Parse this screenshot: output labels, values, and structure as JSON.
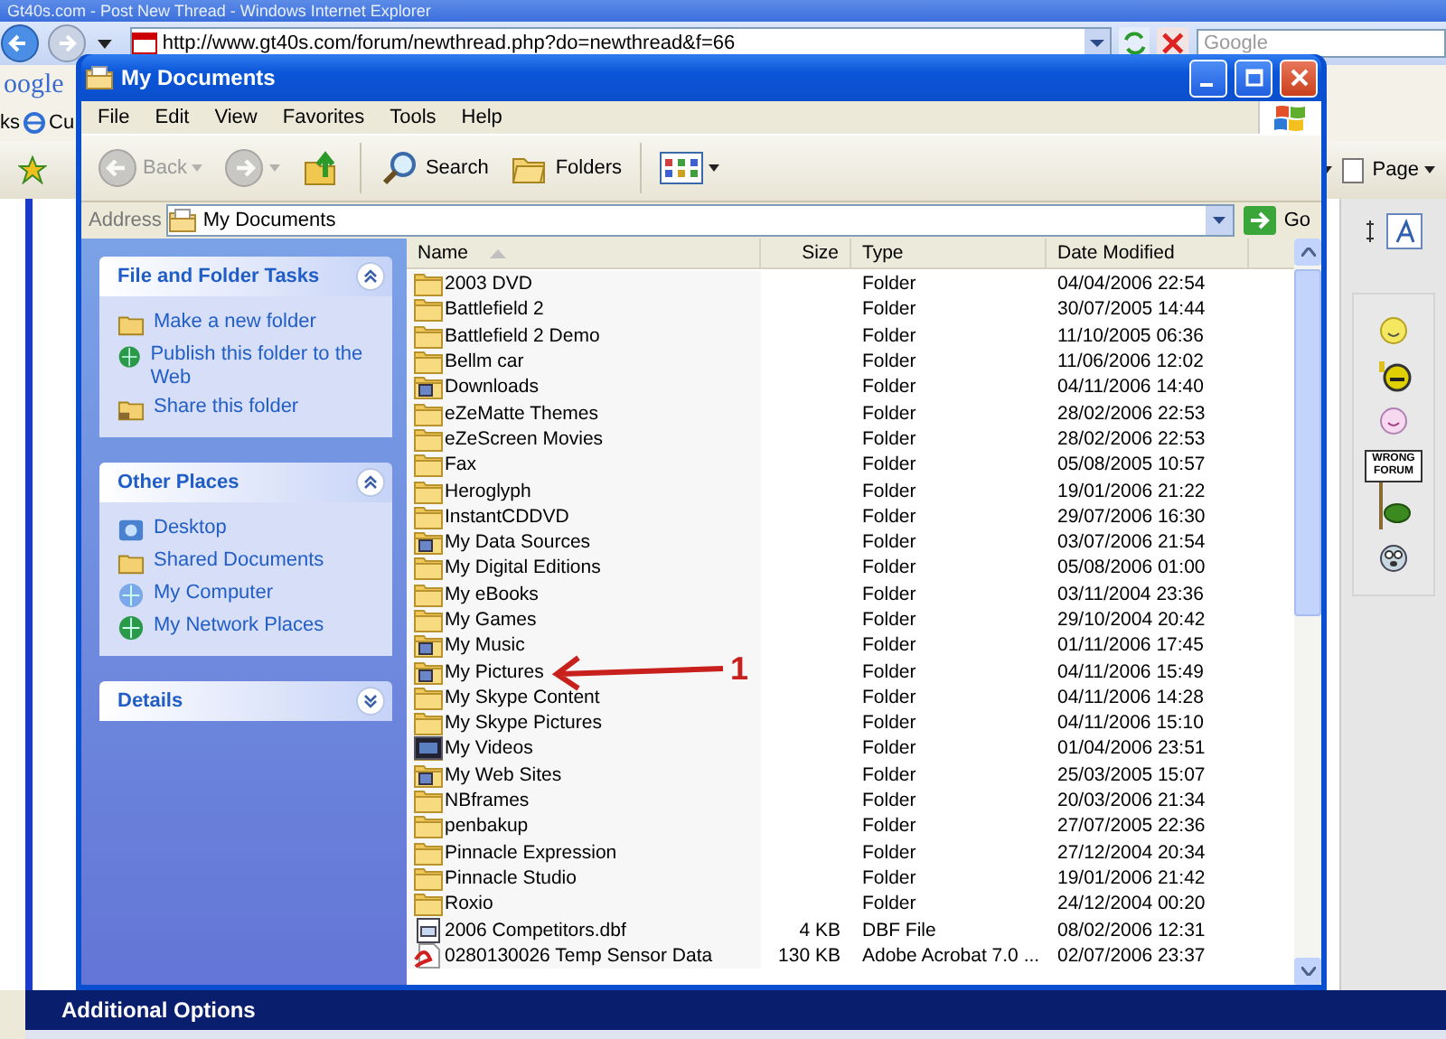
{
  "browser": {
    "title": "Gt40s.com - Post New Thread - Windows Internet Explorer",
    "url": "http://www.gt40s.com/forum/newthread.php?do=newthread&f=66",
    "search": {
      "placeholder": "Google"
    },
    "toolbar_logo": "oogle",
    "links_label": "ks",
    "link": "Cu",
    "page_button": "Page",
    "section_title": "Additional Options",
    "smiley_sign": "WRONG FORUM"
  },
  "window": {
    "title": "My Documents",
    "menu": [
      "File",
      "Edit",
      "View",
      "Favorites",
      "Tools",
      "Help"
    ],
    "toolbar": [
      {
        "kind": "back",
        "label": "Back",
        "disabled": true
      },
      {
        "kind": "forward",
        "disabled": true
      },
      {
        "kind": "up",
        "disabled": false
      },
      {
        "kind": "search",
        "label": "Search",
        "disabled": false
      },
      {
        "kind": "folders",
        "label": "Folders",
        "disabled": false
      },
      {
        "kind": "views",
        "disabled": false
      }
    ],
    "address": {
      "label": "Address",
      "value": "My Documents",
      "go": "Go"
    },
    "panes": [
      {
        "title": "File and Folder Tasks",
        "expanded": true,
        "items": [
          {
            "kind": "new-folder",
            "label": "Make a new folder"
          },
          {
            "kind": "publish",
            "label": "Publish this folder to the Web"
          },
          {
            "kind": "share",
            "label": "Share this folder"
          }
        ]
      },
      {
        "title": "Other Places",
        "expanded": true,
        "items": [
          {
            "kind": "desktop",
            "label": "Desktop"
          },
          {
            "kind": "shared",
            "label": "Shared Documents"
          },
          {
            "kind": "computer",
            "label": "My Computer"
          },
          {
            "kind": "network",
            "label": "My Network Places"
          }
        ]
      },
      {
        "title": "Details",
        "expanded": false
      }
    ],
    "columns": [
      {
        "label": "Name",
        "sorted": true
      },
      {
        "label": "Size",
        "sorted": false
      },
      {
        "label": "Type",
        "sorted": false
      },
      {
        "label": "Date Modified",
        "sorted": false
      }
    ],
    "files": [
      {
        "kind": "folder",
        "name": "2003 DVD",
        "type": "Folder",
        "date": "04/04/2006 22:54"
      },
      {
        "kind": "folder",
        "name": "Battlefield 2",
        "type": "Folder",
        "date": "30/07/2005 14:44"
      },
      {
        "kind": "folder",
        "name": "Battlefield 2 Demo",
        "type": "Folder",
        "date": "11/10/2005 06:36"
      },
      {
        "kind": "folder",
        "name": "Bellm car",
        "type": "Folder",
        "date": "11/06/2006 12:02"
      },
      {
        "kind": "special",
        "name": "Downloads",
        "type": "Folder",
        "date": "04/11/2006 14:40"
      },
      {
        "kind": "folder",
        "name": "eZeMatte Themes",
        "type": "Folder",
        "date": "28/02/2006 22:53"
      },
      {
        "kind": "folder",
        "name": "eZeScreen Movies",
        "type": "Folder",
        "date": "28/02/2006 22:53"
      },
      {
        "kind": "folder",
        "name": "Fax",
        "type": "Folder",
        "date": "05/08/2005 10:57"
      },
      {
        "kind": "folder",
        "name": "Heroglyph",
        "type": "Folder",
        "date": "19/01/2006 21:22"
      },
      {
        "kind": "folder",
        "name": "InstantCDDVD",
        "type": "Folder",
        "date": "29/07/2006 16:30"
      },
      {
        "kind": "special",
        "name": "My Data Sources",
        "type": "Folder",
        "date": "03/07/2006 21:54"
      },
      {
        "kind": "folder",
        "name": "My Digital Editions",
        "type": "Folder",
        "date": "05/08/2006 01:00"
      },
      {
        "kind": "folder",
        "name": "My eBooks",
        "type": "Folder",
        "date": "03/11/2004 23:36"
      },
      {
        "kind": "folder",
        "name": "My Games",
        "type": "Folder",
        "date": "29/10/2004 20:42"
      },
      {
        "kind": "special",
        "name": "My Music",
        "type": "Folder",
        "date": "01/11/2006 17:45"
      },
      {
        "kind": "special",
        "name": "My Pictures",
        "type": "Folder",
        "date": "04/11/2006 15:49"
      },
      {
        "kind": "folder",
        "name": "My Skype Content",
        "type": "Folder",
        "date": "04/11/2006 14:28"
      },
      {
        "kind": "folder",
        "name": "My Skype Pictures",
        "type": "Folder",
        "date": "04/11/2006 15:10"
      },
      {
        "kind": "video",
        "name": "My Videos",
        "type": "Folder",
        "date": "01/04/2006 23:51"
      },
      {
        "kind": "special",
        "name": "My Web Sites",
        "type": "Folder",
        "date": "25/03/2005 15:07"
      },
      {
        "kind": "folder",
        "name": "NBframes",
        "type": "Folder",
        "date": "20/03/2006 21:34"
      },
      {
        "kind": "folder",
        "name": "penbakup",
        "type": "Folder",
        "date": "27/07/2005 22:36"
      },
      {
        "kind": "folder",
        "name": "Pinnacle Expression",
        "type": "Folder",
        "date": "27/12/2004 20:34"
      },
      {
        "kind": "folder",
        "name": "Pinnacle Studio",
        "type": "Folder",
        "date": "19/01/2006 21:42"
      },
      {
        "kind": "folder",
        "name": "Roxio",
        "type": "Folder",
        "date": "24/12/2004 00:20"
      },
      {
        "kind": "file",
        "name": "2006 Competitors.dbf",
        "size": "4 KB",
        "type": "DBF File",
        "date": "08/02/2006 12:31"
      },
      {
        "kind": "pdf",
        "name": "0280130026 Temp Sensor Data",
        "size": "130 KB",
        "type": "Adobe Acrobat 7.0 ...",
        "date": "02/07/2006 23:37"
      }
    ]
  },
  "annotation": {
    "label": "1"
  }
}
